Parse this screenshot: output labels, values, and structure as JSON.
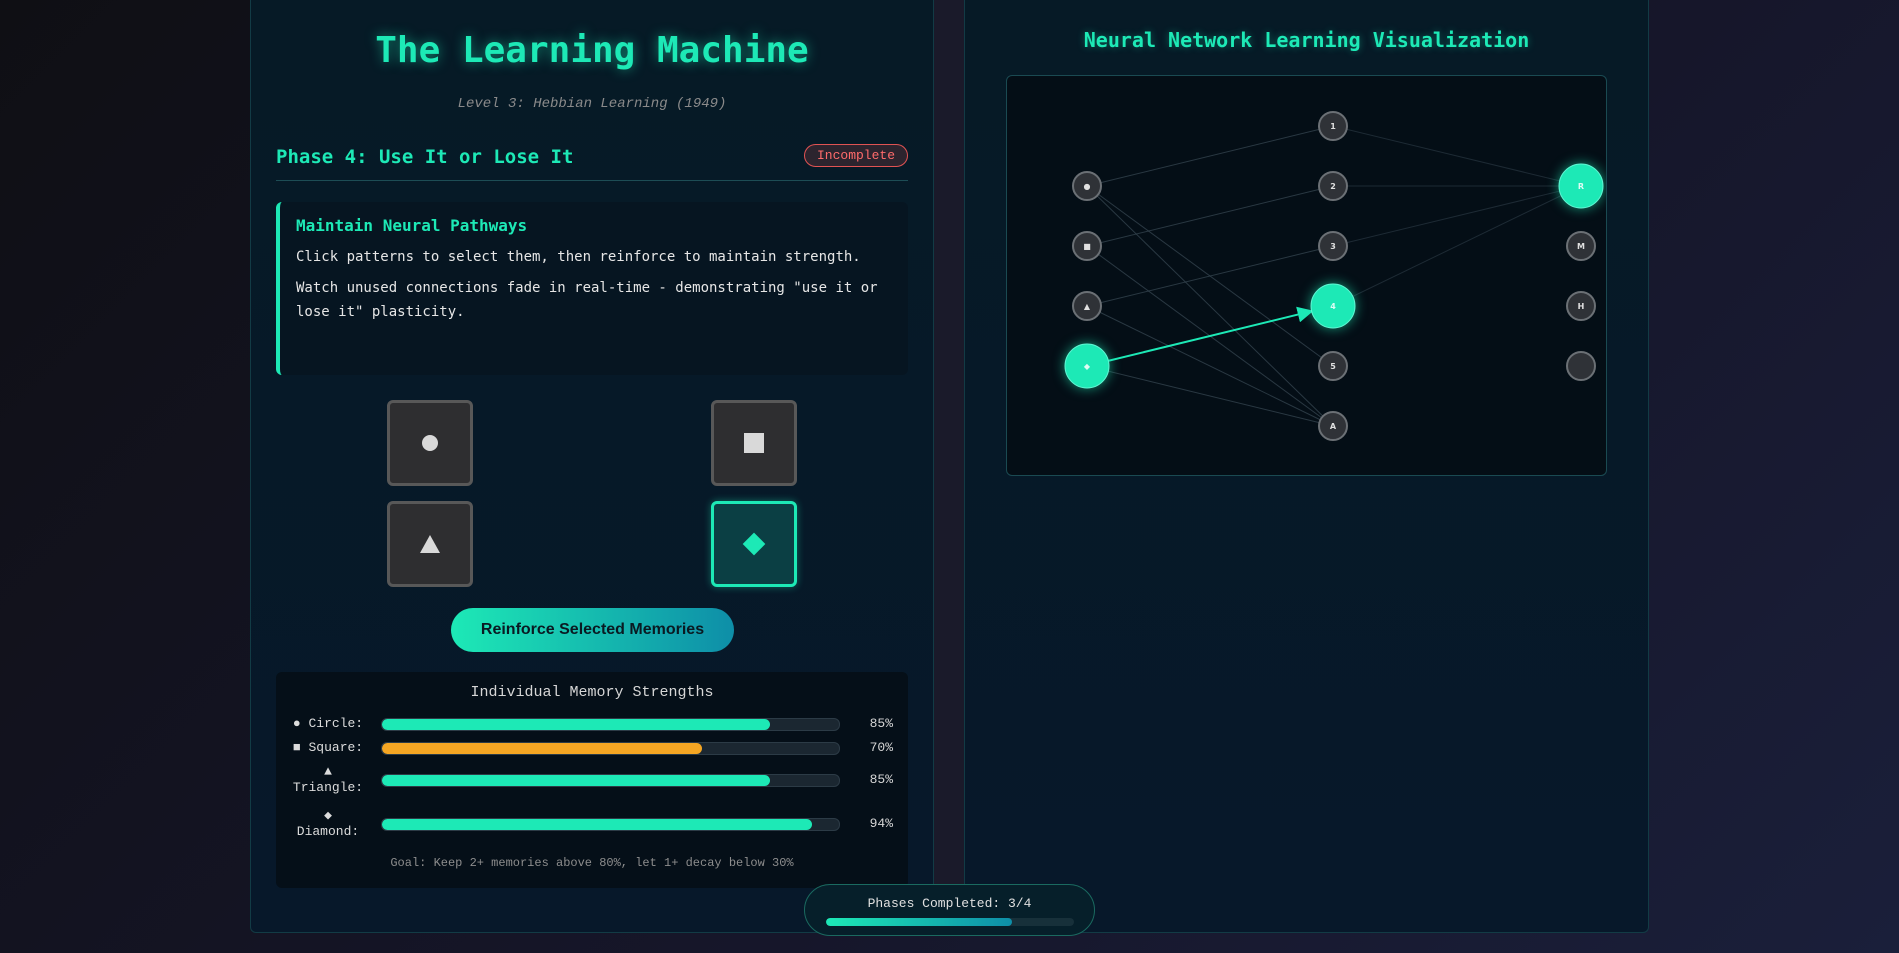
{
  "header": {
    "title": "The Learning Machine",
    "subtitle": "Level 3: Hebbian Learning (1949)"
  },
  "phase": {
    "title": "Phase 4: Use It or Lose It",
    "status": "Incomplete"
  },
  "instructions": {
    "heading": "Maintain Neural Pathways",
    "line1": "Click patterns to select them, then reinforce to maintain strength.",
    "line2": "Watch unused connections fade in real-time - demonstrating \"use it or lose it\" plasticity."
  },
  "patterns": [
    {
      "name": "circle",
      "icon": "circle-icon",
      "selected": false
    },
    {
      "name": "square",
      "icon": "square-icon",
      "selected": false
    },
    {
      "name": "triangle",
      "icon": "triangle-icon",
      "selected": false
    },
    {
      "name": "diamond",
      "icon": "diamond-icon",
      "selected": true
    }
  ],
  "reinforce_label": "Reinforce Selected Memories",
  "strengths": {
    "title": "Individual Memory Strengths",
    "items": [
      {
        "symbol": "●",
        "label": "Circle:",
        "value": 85,
        "display": "85%"
      },
      {
        "symbol": "■",
        "label": "Square:",
        "value": 70,
        "display": "70%"
      },
      {
        "symbol": "▲",
        "label": "Triangle:",
        "value": 85,
        "display": "85%"
      },
      {
        "symbol": "◆",
        "label": "Diamond:",
        "value": 94,
        "display": "94%"
      }
    ],
    "goal": "Goal: Keep 2+ memories above 80%, let 1+ decay below 30%"
  },
  "visualization": {
    "title": "Neural Network Learning Visualization",
    "input_nodes": [
      "●",
      "■",
      "▲",
      "◆"
    ],
    "hidden_nodes": [
      "1",
      "2",
      "3",
      "4",
      "5",
      "A"
    ],
    "output_nodes": [
      "R",
      "M",
      "H",
      ""
    ],
    "active": {
      "input": "◆",
      "hidden": "4",
      "output": "R"
    }
  },
  "progress": {
    "label": "Phases Completed: 3/4",
    "completed": 3,
    "total": 4
  },
  "colors": {
    "accent": "#1de9b6",
    "warning": "#f5a623",
    "danger": "#ff6b6b"
  }
}
